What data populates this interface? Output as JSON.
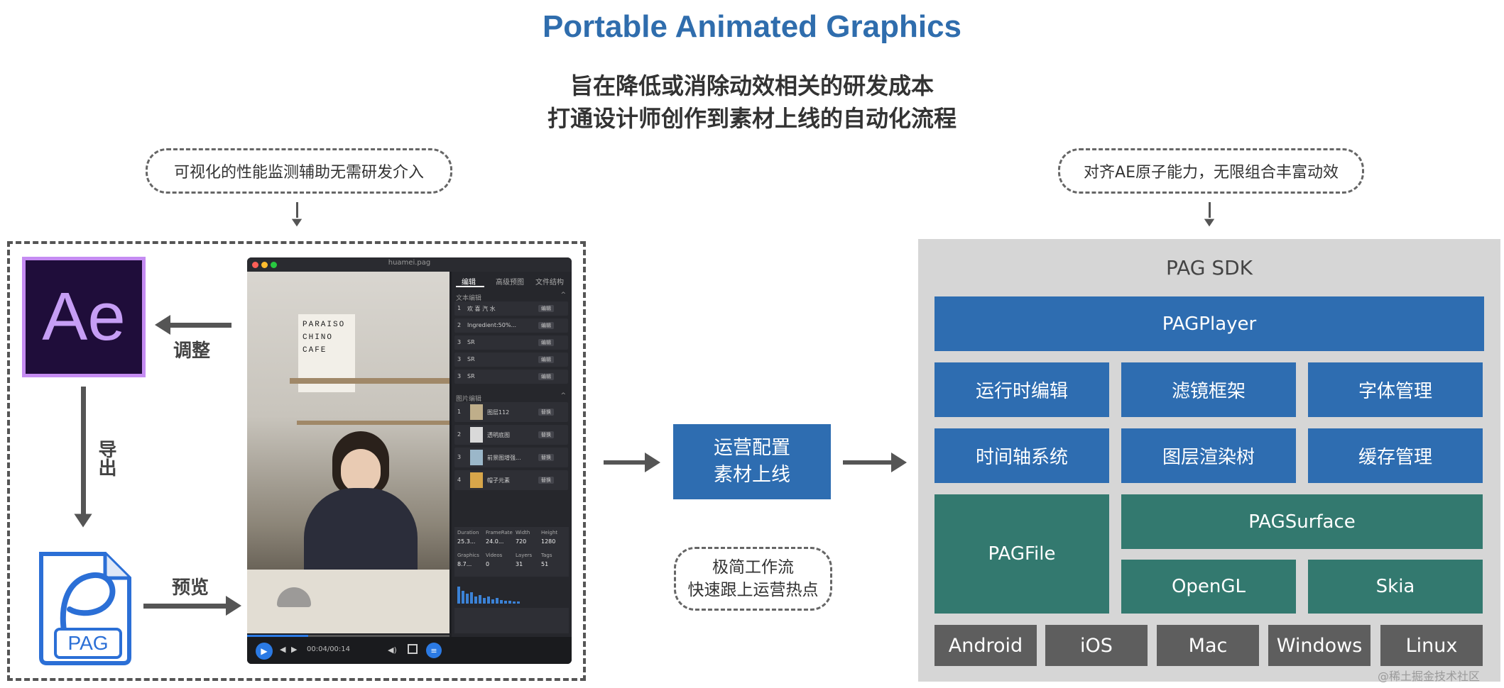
{
  "header": {
    "title": "Portable Animated Graphics",
    "subtitle_1": "旨在降低或消除动效相关的研发成本",
    "subtitle_2": "打通设计师创作到素材上线的自动化流程"
  },
  "notes": {
    "left": "可视化的性能监测辅助无需研发介入",
    "right": "对齐AE原子能力，无限组合丰富动效",
    "middle_1": "极简工作流",
    "middle_2": "快速跟上运营热点"
  },
  "workflow": {
    "ae_logo_text": "Ae",
    "label_adjust": "调整",
    "label_export": "导出",
    "label_preview": "预览",
    "pag_logo_text": "PAG"
  },
  "player": {
    "filename": "huamei.pag",
    "tabs": [
      "编辑",
      "高级预图",
      "文件结构"
    ],
    "text_section": "文本编辑",
    "text_rows": [
      {
        "index": "1",
        "label": "欢 喜 汽 水",
        "badge": "编辑"
      },
      {
        "index": "2",
        "label": "Ingredient:50%...",
        "badge": "编辑"
      },
      {
        "index": "3",
        "label": "SR",
        "badge": "编辑"
      },
      {
        "index": "3",
        "label": "SR",
        "badge": "编辑"
      },
      {
        "index": "3",
        "label": "SR",
        "badge": "编辑"
      }
    ],
    "image_section": "图片编辑",
    "image_rows": [
      {
        "index": "1",
        "label": "图层112",
        "badge": "替换"
      },
      {
        "index": "2",
        "label": "透明底图",
        "badge": "替换"
      },
      {
        "index": "3",
        "label": "前景图增强...",
        "badge": "替换"
      },
      {
        "index": "4",
        "label": "帽子元素",
        "badge": "替换"
      }
    ],
    "stats_headers": [
      "Duration",
      "FrameRate",
      "Width",
      "Height"
    ],
    "stats_values": [
      "25.3...",
      "24.0...",
      "720",
      "1280"
    ],
    "stats_headers_2": [
      "Graphics",
      "Videos",
      "Layers",
      "Tags"
    ],
    "stats_values_2": [
      "8.7...",
      "0",
      "31",
      "51"
    ],
    "time": "00:04/00:14",
    "progress": 0.3,
    "poster_text": [
      "PARAISO",
      "CHINO",
      "CAFE"
    ]
  },
  "ops_box": {
    "line_1": "运营配置",
    "line_2": "素材上线"
  },
  "sdk": {
    "title": "PAG SDK",
    "player": "PAGPlayer",
    "row_1": [
      "运行时编辑",
      "滤镜框架",
      "字体管理"
    ],
    "row_2": [
      "时间轴系统",
      "图层渲染树",
      "缓存管理"
    ],
    "pag_file": "PAGFile",
    "pag_surface": "PAGSurface",
    "opengl": "OpenGL",
    "skia": "Skia",
    "platforms": [
      "Android",
      "iOS",
      "Mac",
      "Windows",
      "Linux"
    ]
  },
  "watermark": "@稀土掘金技术社区",
  "colors": {
    "title_blue": "#2f6dad",
    "box_blue": "#2e6db1",
    "box_teal": "#33796f",
    "box_gray": "#5e5e5e",
    "sdk_bg": "#d6d6d6"
  }
}
